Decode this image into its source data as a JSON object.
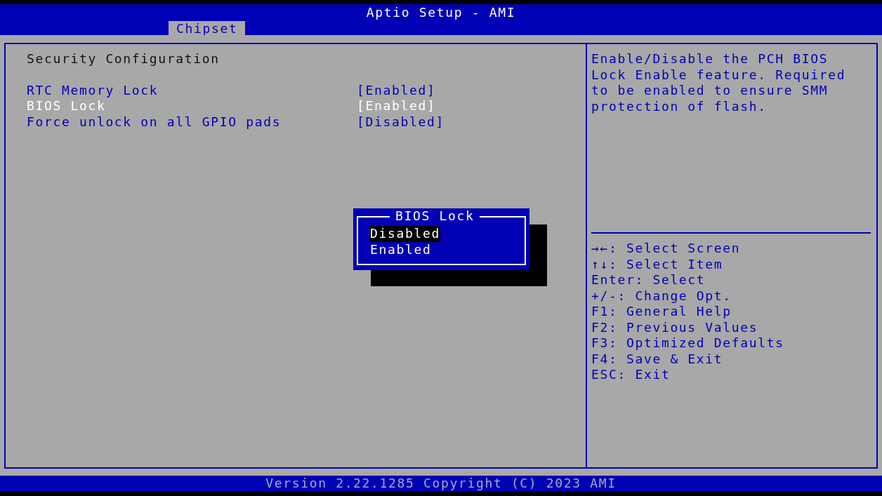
{
  "header": {
    "title": "Aptio Setup - AMI"
  },
  "tabs": [
    {
      "label": "Chipset",
      "selected": true
    }
  ],
  "section_title": "Security Configuration",
  "settings": [
    {
      "label": "RTC Memory Lock",
      "value": "[Enabled]",
      "selected": false
    },
    {
      "label": "BIOS Lock",
      "value": "[Enabled]",
      "selected": true
    },
    {
      "label": "Force unlock on all GPIO pads",
      "value": "[Disabled]",
      "selected": false
    }
  ],
  "popup": {
    "title": "BIOS Lock",
    "options": [
      {
        "label": "Disabled",
        "selected": true
      },
      {
        "label": "Enabled",
        "selected": false
      }
    ]
  },
  "help_text": "Enable/Disable the PCH BIOS Lock Enable feature. Required to be enabled to ensure SMM protection of flash.",
  "key_help": [
    "→←: Select Screen",
    "↑↓: Select Item",
    "Enter: Select",
    "+/-: Change Opt.",
    "F1: General Help",
    "F2: Previous Values",
    "F3: Optimized Defaults",
    "F4: Save & Exit",
    "ESC: Exit"
  ],
  "footer": "Version 2.22.1285 Copyright (C) 2023 AMI"
}
